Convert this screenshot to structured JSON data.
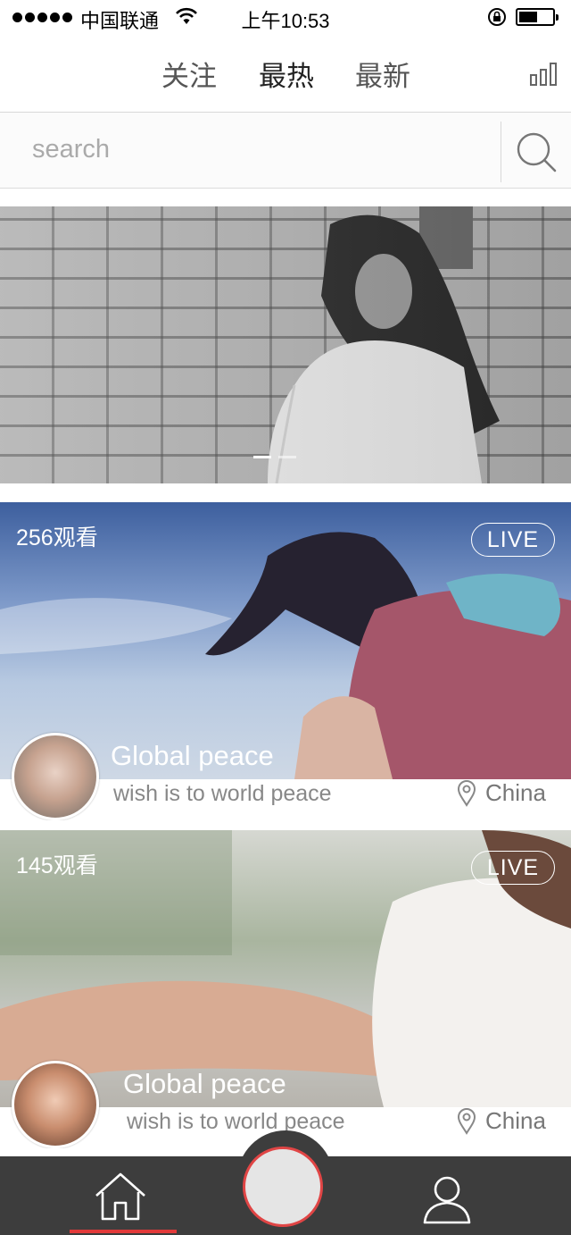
{
  "status_bar": {
    "carrier": "中国联通",
    "time": "上午10:53",
    "battery_level": 0.55
  },
  "nav": {
    "tabs": [
      {
        "label": "关注"
      },
      {
        "label": "最热"
      },
      {
        "label": "最新"
      }
    ],
    "right_icon": "rank-bars-icon"
  },
  "search": {
    "placeholder": "search",
    "button_icon": "search-icon"
  },
  "banner": {
    "slide_count": 2,
    "active_slide": 1
  },
  "cards": [
    {
      "viewers": "256观看",
      "badge": "LIVE",
      "title": "Global peace",
      "subtitle": "wish is to world peace",
      "location": "China"
    },
    {
      "viewers": "145观看",
      "badge": "LIVE",
      "title": "Global peace",
      "subtitle": "wish is to world peace",
      "location": "China"
    }
  ],
  "tab_bar": {
    "left_icon": "home-icon",
    "right_icon": "user-icon",
    "accent_color": "#e23a3a"
  }
}
